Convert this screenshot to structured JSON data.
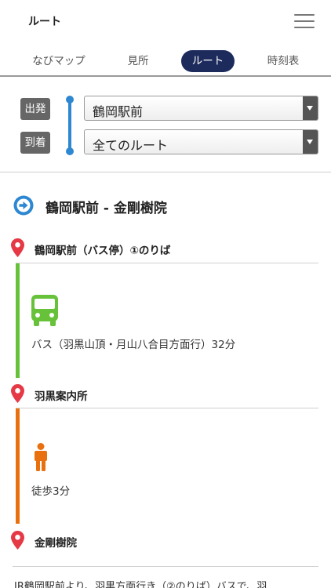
{
  "header": {
    "title": "ルート",
    "menu_icon": "hamburger-menu-icon"
  },
  "tabs": [
    {
      "label": "なびマップ",
      "active": false
    },
    {
      "label": "見所",
      "active": false
    },
    {
      "label": "ルート",
      "active": true
    },
    {
      "label": "時刻表",
      "active": false
    }
  ],
  "form": {
    "departure_label": "出発",
    "arrival_label": "到着",
    "departure_value": "鶴岡駅前",
    "arrival_value": "全てのルート",
    "accent_color": "#2e87d1"
  },
  "route": {
    "title": "鶴岡駅前 - 金剛樹院",
    "icon": "circle-arrow-right-icon",
    "stops": [
      {
        "name": "鶴岡駅前（バス停）①のりば"
      },
      {
        "name": "羽黒案内所"
      },
      {
        "name": "金剛樹院"
      }
    ],
    "segments": [
      {
        "mode": "bus",
        "icon": "bus-icon",
        "text": "バス（羽黒山頂・月山八合目方面行）32分",
        "color": "#67c23a"
      },
      {
        "mode": "walk",
        "icon": "walking-person-icon",
        "text": "徒歩3分",
        "color": "#e8700f"
      }
    ]
  },
  "footer": {
    "text": "JR鶴岡駅前より、羽黒方面行き（②のりば）バスで、羽"
  }
}
